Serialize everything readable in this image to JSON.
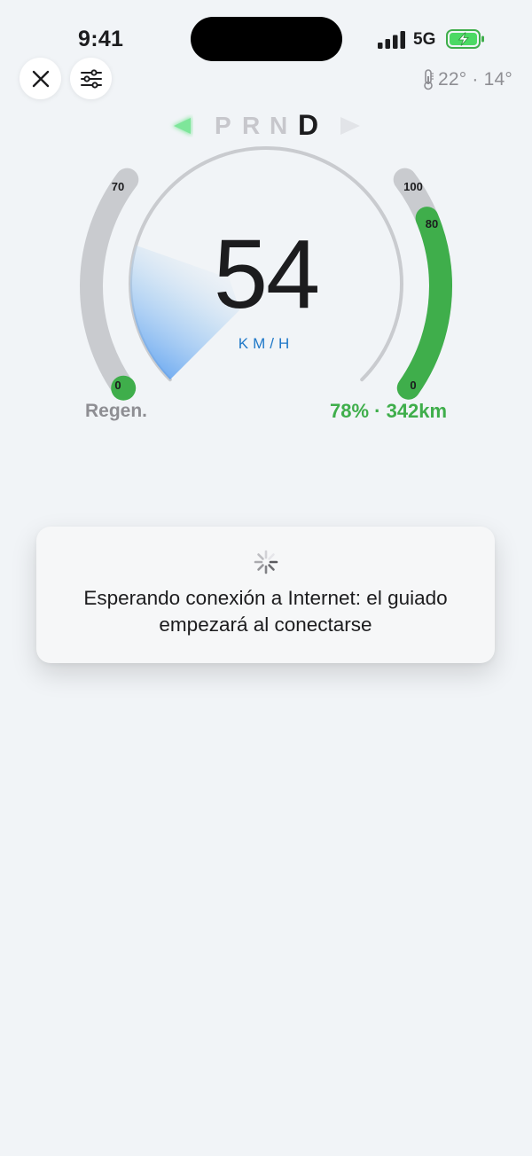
{
  "status_bar": {
    "time": "9:41",
    "network": "5G"
  },
  "header": {
    "close_icon": "close-icon",
    "filter_icon": "sliders-icon",
    "temperature": "22° · 14°"
  },
  "gear_selector": {
    "gears": [
      "P",
      "R",
      "N",
      "D"
    ],
    "active": "D"
  },
  "speedometer": {
    "speed": "54",
    "unit": "KM/H",
    "speed_fraction": 0.35
  },
  "regen_gauge": {
    "max_label": "70",
    "min_label": "0",
    "label": "Regen.",
    "level": 0.0
  },
  "battery_gauge": {
    "max_label": "100",
    "level_label": "80",
    "min_label": "0",
    "level": 0.8,
    "summary": "78% · 342km"
  },
  "toast": {
    "message": "Esperando conexión a Internet: el guiado empezará al conectarse"
  },
  "colors": {
    "accent_green": "#3fae4b",
    "accent_blue": "#1f78c8",
    "track_gray": "#c9cbcf"
  }
}
